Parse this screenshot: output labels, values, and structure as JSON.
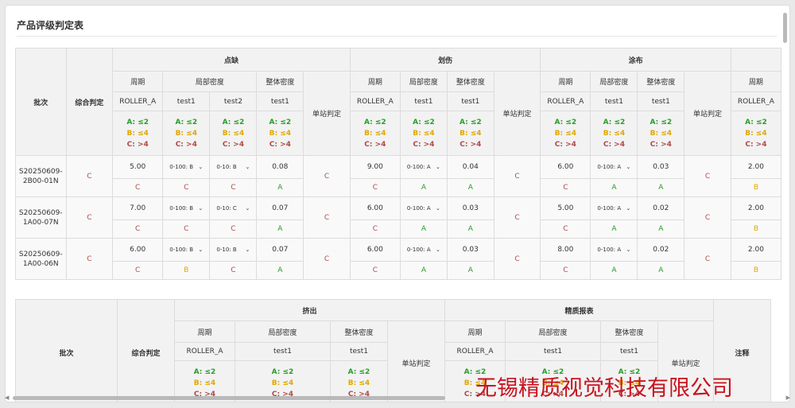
{
  "title": "产品评级判定表",
  "crit": {
    "a": "A: ≤2",
    "b": "B: ≤4",
    "c": "C: >4"
  },
  "t1": {
    "head": {
      "batch": "批次",
      "overall": "综合判定",
      "station": "单站判定",
      "g1": "点缺",
      "g2": "划伤",
      "g3": "涂布",
      "period": "周期",
      "local": "局部密度",
      "whole": "整体密度",
      "roller": "ROLLER_A",
      "test1": "test1",
      "test2": "test2"
    },
    "rows": [
      {
        "batch": "S20250609-2B00-01N",
        "overall": "C",
        "g1": {
          "p": "5.00",
          "pg": "C",
          "l1": "0-100: B",
          "l1g": "C",
          "l2": "0-10: B",
          "l2g": "C",
          "w": "0.08",
          "wg": "A",
          "s": "C"
        },
        "g2": {
          "p": "9.00",
          "pg": "C",
          "l1": "0-100: A",
          "l1g": "A",
          "w": "0.04",
          "wg": "A",
          "s": "C"
        },
        "g3": {
          "p": "6.00",
          "pg": "C",
          "l1": "0-100: A",
          "l1g": "A",
          "w": "0.03",
          "wg": "A",
          "s": "C"
        },
        "g4": {
          "p": "2.00",
          "pg": "B"
        }
      },
      {
        "batch": "S20250609-1A00-07N",
        "overall": "C",
        "g1": {
          "p": "7.00",
          "pg": "C",
          "l1": "0-100: B",
          "l1g": "C",
          "l2": "0-10: C",
          "l2g": "C",
          "w": "0.07",
          "wg": "A",
          "s": "C"
        },
        "g2": {
          "p": "6.00",
          "pg": "C",
          "l1": "0-100: A",
          "l1g": "A",
          "w": "0.03",
          "wg": "A",
          "s": "C"
        },
        "g3": {
          "p": "5.00",
          "pg": "C",
          "l1": "0-100: A",
          "l1g": "A",
          "w": "0.02",
          "wg": "A",
          "s": "C"
        },
        "g4": {
          "p": "2.00",
          "pg": "B"
        }
      },
      {
        "batch": "S20250609-1A00-06N",
        "overall": "C",
        "g1": {
          "p": "6.00",
          "pg": "C",
          "l1": "0-100: B",
          "l1g": "B",
          "l2": "0-10: B",
          "l2g": "C",
          "w": "0.07",
          "wg": "A",
          "s": "C"
        },
        "g2": {
          "p": "6.00",
          "pg": "C",
          "l1": "0-100: A",
          "l1g": "A",
          "w": "0.03",
          "wg": "A",
          "s": "C"
        },
        "g3": {
          "p": "8.00",
          "pg": "C",
          "l1": "0-100: A",
          "l1g": "A",
          "w": "0.02",
          "wg": "A",
          "s": "C"
        },
        "g4": {
          "p": "2.00",
          "pg": "B"
        }
      }
    ]
  },
  "t2": {
    "head": {
      "batch": "批次",
      "overall": "综合判定",
      "station": "单站判定",
      "note": "注释",
      "g1": "挤出",
      "g2": "精质报表",
      "period": "周期",
      "local": "局部密度",
      "whole": "整体密度",
      "roller": "ROLLER_A",
      "test1": "test1"
    }
  },
  "watermark": "无锡精质视觉科技有限公司",
  "icons": {
    "dropdown": "chevron-down-icon",
    "scroll_left": "arrow-left-icon",
    "scroll_right": "arrow-right-icon"
  },
  "colors": {
    "grade_a": "#2a9d2a",
    "grade_b": "#e0a800",
    "grade_c": "#b04a4a",
    "watermark": "#c8131f"
  }
}
